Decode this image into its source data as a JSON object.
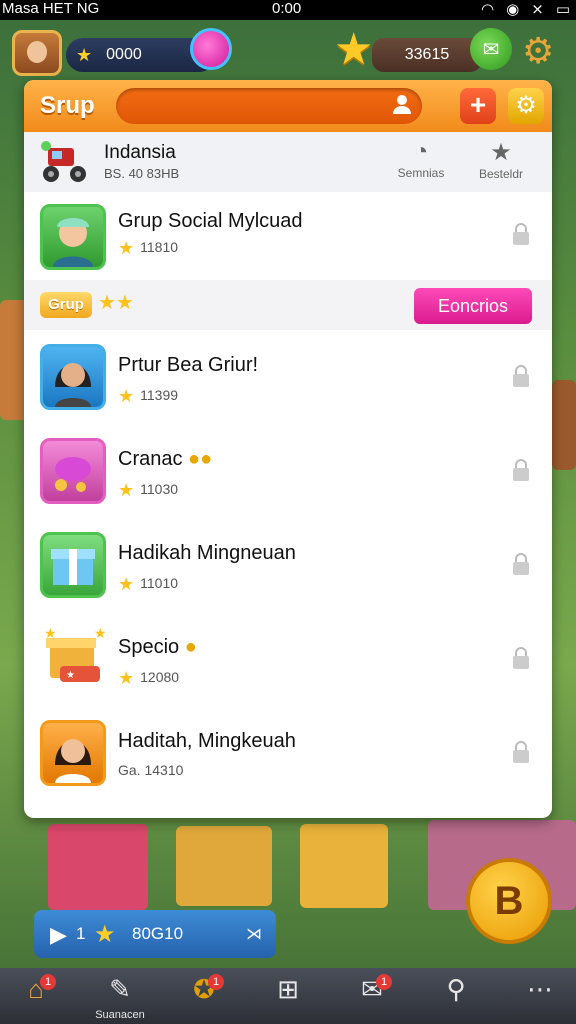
{
  "status_bar": {
    "carrier": "Masa HET NG",
    "time": "0:00"
  },
  "hud": {
    "coins": "0000",
    "gems": "33615"
  },
  "panel": {
    "title": "Srup",
    "info": {
      "name": "Indansia",
      "sub": "BS. 40 83HB",
      "btn1_label": "Semnias",
      "btn2_label": "Besteldr"
    },
    "band": {
      "tag": "Grup",
      "button": "Eoncrios"
    },
    "rows": [
      {
        "title": "Grup Social Mylcuad",
        "sub": "11810"
      },
      {
        "title": "Prtur Bea Griur!",
        "sub": "11399"
      },
      {
        "title": "Cranac",
        "sub": "11030"
      },
      {
        "title": "Hadikah Mingneuan",
        "sub": "11010"
      },
      {
        "title": "Specio",
        "sub": "12080"
      },
      {
        "title": "Haditah, Mingkeuah",
        "sub": "Ga. 14310"
      }
    ]
  },
  "bottom": {
    "level": "1",
    "value": "80G10",
    "coin_letter": "B"
  },
  "nav": {
    "item2_label": "Suanacen",
    "badge1": "1",
    "badge3": "1",
    "badge5": "1"
  }
}
